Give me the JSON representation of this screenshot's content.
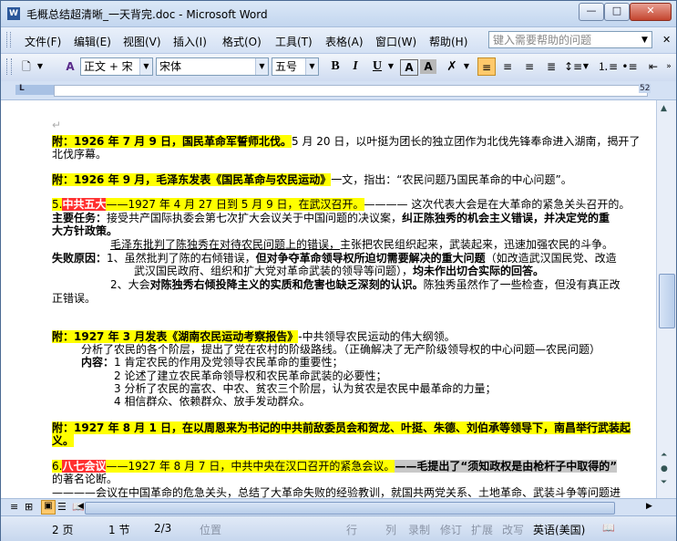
{
  "window": {
    "title": "毛概总结超清晰_一天背完.doc - Microsoft Word",
    "app_icon": "W"
  },
  "menu": {
    "items": [
      "文件(F)",
      "编辑(E)",
      "视图(V)",
      "插入(I)",
      "格式(O)",
      "工具(T)",
      "表格(A)",
      "窗口(W)",
      "帮助(H)"
    ],
    "help_placeholder": "键入需要帮助的问题"
  },
  "toolbar": {
    "style_value": "正文 + 宋",
    "font_value": "宋体",
    "size_value": "五号",
    "bold": "B",
    "italic": "I",
    "underline": "U",
    "font_color_glyph": "A"
  },
  "ruler": {
    "left_mark": "L",
    "right_num": "52"
  },
  "document": {
    "p1_bold": "附：1926 年 7 月 9 日，国民革命军誓师北伐。",
    "p1_rest": "5 月 20 日，以叶挺为团长的独立团作为北伐先锋奉命进入湖南，揭开了",
    "p1_line2": "北伐序幕。",
    "p2_bold": "附：1926 年 9 月，毛泽东发表《国民革命与农民运动》",
    "p2_rest": "一文，指出：“农民问题乃国民革命的中心问题”。",
    "p3_num": "5.",
    "p3_red": "中共五大",
    "p3_hl": "——1927 年 4 月 27 日到 5 月 9 日，在武汉召开。",
    "p3_rest": "———— 这次代表大会是在大革命的紧急关头召开的。",
    "p4_label": "主要任务：",
    "p4_text": "接受共产国际执委会第七次扩大会议关于中国问题的决议案，",
    "p4_bold": "纠正陈独秀的机会主义错误，并决定党的重",
    "p4_line2": "大方针政策。",
    "p5_under": "毛泽东批判了陈独秀在对待农民问题上的错误，",
    "p5_rest": "主张把农民组织起来，武装起来，迅速加强农民的斗争。",
    "p6_label": "失败原因：",
    "p6_text1": "1、虽然批判了陈的右倾错误，",
    "p6_bold": "但对争夺革命领导权所迫切需要解决的重大问题",
    "p6_text2": "（如改造武汉国民党、改造",
    "p6_line2a": "武汉国民政府、组织和扩大党对革命武装的领导等问题），",
    "p6_line2b": "均未作出切合实际的回答。",
    "p7_text1": "2、大会",
    "p7_bold": "对陈独秀右倾投降主义的实质和危害也缺乏深刻的认识。",
    "p7_text2": "陈独秀虽然作了一些检查，但没有真正改",
    "p7_line2": "正错误。",
    "p8_bold": "附：1927 年 3 月发表《湖南农民运动考察报告》",
    "p8_rest": "-中共领导农民运动的伟大纲领。",
    "p8_line2": "分析了农民的各个阶层，提出了党在农村的阶级路线。（正确解决了无产阶级领导权的中心问题—农民问题）",
    "p8_content_label": "内容：",
    "p8_c1": "1 肯定农民的作用及党领导农民革命的重要性；",
    "p8_c2": "2 论述了建立农民革命领导权和农民革命武装的必要性；",
    "p8_c3": "3 分析了农民的富农、中农、贫农三个阶层，认为贫农是农民中最革命的力量；",
    "p8_c4": "4 相信群众、依赖群众、放手发动群众。",
    "p9_bold": "附：1927 年 8 月 1 日，在以周恩来为书记的中共前敌委员会和贺龙、叶挺、朱德、刘伯承等领导下，南昌举行武装起",
    "p9_line2": "义。",
    "p10_num": "6.",
    "p10_red": "八七会议",
    "p10_hl": "——1927 年 8 月 7 日，中共中央在汉口召开的紧急会议。",
    "p10_gray": "——毛提出了“须知政权是由枪杆子中取得的”",
    "p10_line2": "的著名论断。",
    "p10_line3": "————会议在中国革命的危急关头，总结了大革命失败的经验教训，就国共两党关系、土地革命、武装斗争等问题进"
  },
  "status": {
    "page": "2 页",
    "section": "1 节",
    "pages": "2/3",
    "position": "位置",
    "line": "行",
    "col": "列",
    "rec": "录制",
    "trk": "修订",
    "ext": "扩展",
    "ovr": "改写",
    "lang": "英语(美国)"
  },
  "colors": {
    "highlight": "#ffff00",
    "red_highlight": "#ff3030",
    "window_frame": "#c3daf9"
  }
}
